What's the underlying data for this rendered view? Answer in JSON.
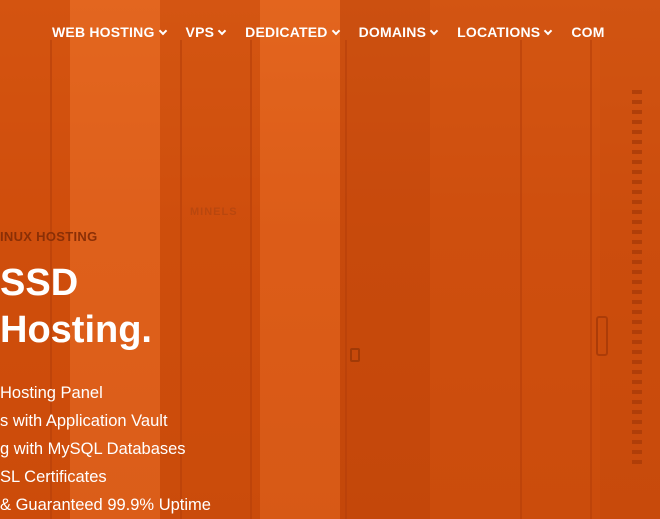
{
  "nav": {
    "items": [
      {
        "label": "WEB HOSTING",
        "dropdown": true
      },
      {
        "label": "VPS",
        "dropdown": true
      },
      {
        "label": "DEDICATED",
        "dropdown": true
      },
      {
        "label": "DOMAINS",
        "dropdown": true
      },
      {
        "label": "LOCATIONS",
        "dropdown": true
      },
      {
        "label": "COM",
        "dropdown": false
      }
    ]
  },
  "hero": {
    "eyebrow": "INUX HOSTING",
    "title_line1": "SSD",
    "title_line2": " Hosting.",
    "features": [
      " Hosting Panel",
      "s with Application Vault",
      "g with MySQL Databases",
      "SL Certificates",
      " & Guaranteed 99.9% Uptime"
    ],
    "rack_label": "MINELS"
  },
  "colors": {
    "overlay": "#d9560f",
    "eyebrow": "#8a2f06",
    "text": "#ffffff"
  }
}
